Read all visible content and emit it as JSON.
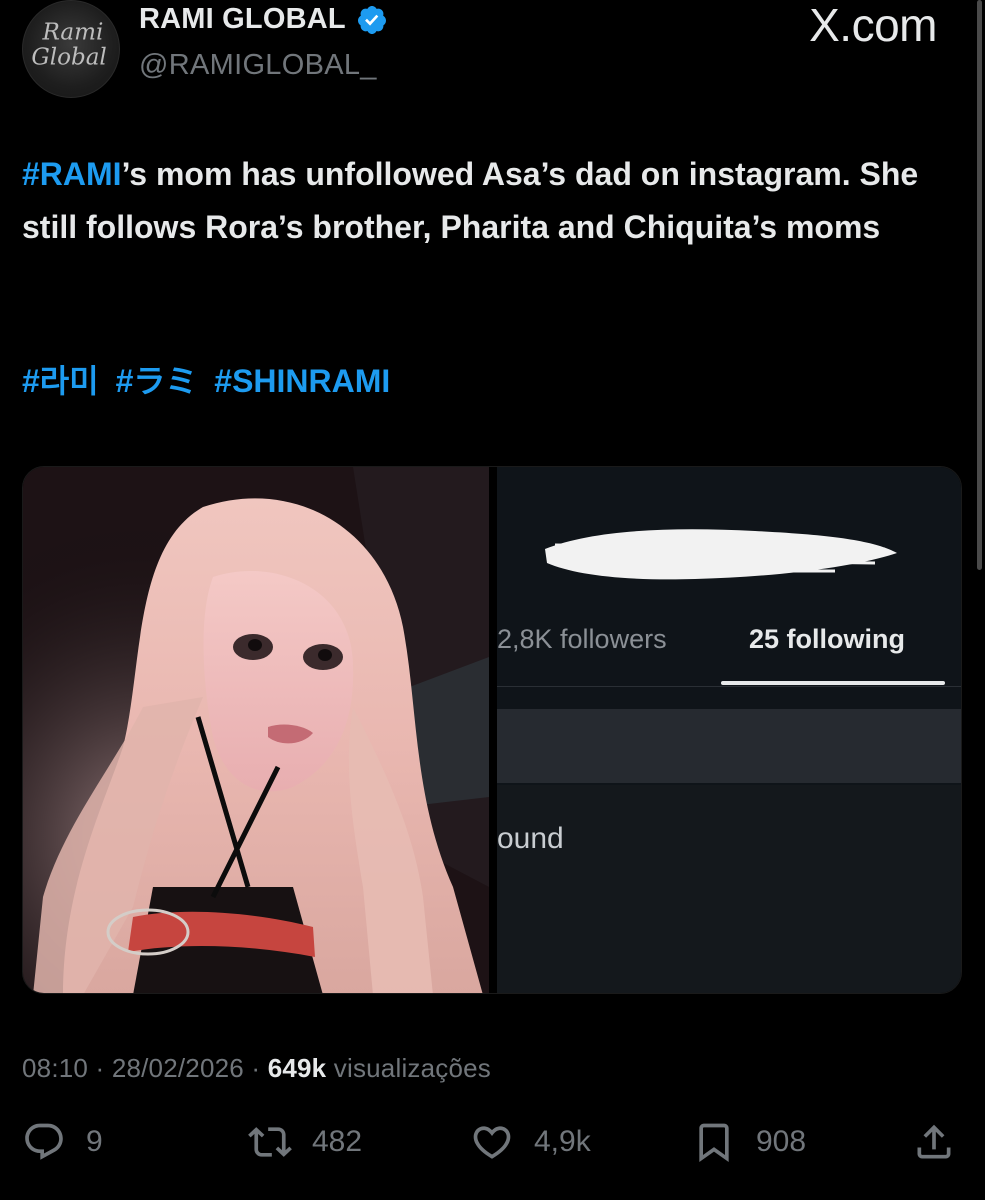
{
  "source_label": "X.com",
  "author": {
    "name": "RAMI GLOBAL",
    "handle": "@RAMIGLOBAL_",
    "avatar_text_line1": "Rami",
    "avatar_text_line2": "Global",
    "verified": true
  },
  "tweet": {
    "hashtag_lead": "#RAMI",
    "text": "’s mom has unfollowed Asa’s dad on instagram. She still follows Rora’s brother, Pharita and Chiquita’s moms",
    "hashtags": [
      "#라미",
      "#ラミ",
      "#SHINRAMI"
    ]
  },
  "media": {
    "instagram": {
      "followers_label": "2,8K followers",
      "following_label": "25 following",
      "list_text": "ound"
    }
  },
  "meta": {
    "time": "08:10",
    "date": "28/02/2026",
    "views_count": "649k",
    "views_label": "visualizações"
  },
  "actions": {
    "replies": "9",
    "reposts": "482",
    "likes": "4,9k",
    "bookmarks": "908"
  },
  "colors": {
    "background": "#000000",
    "accent": "#1d9bf0",
    "secondary_text": "#71767b"
  }
}
